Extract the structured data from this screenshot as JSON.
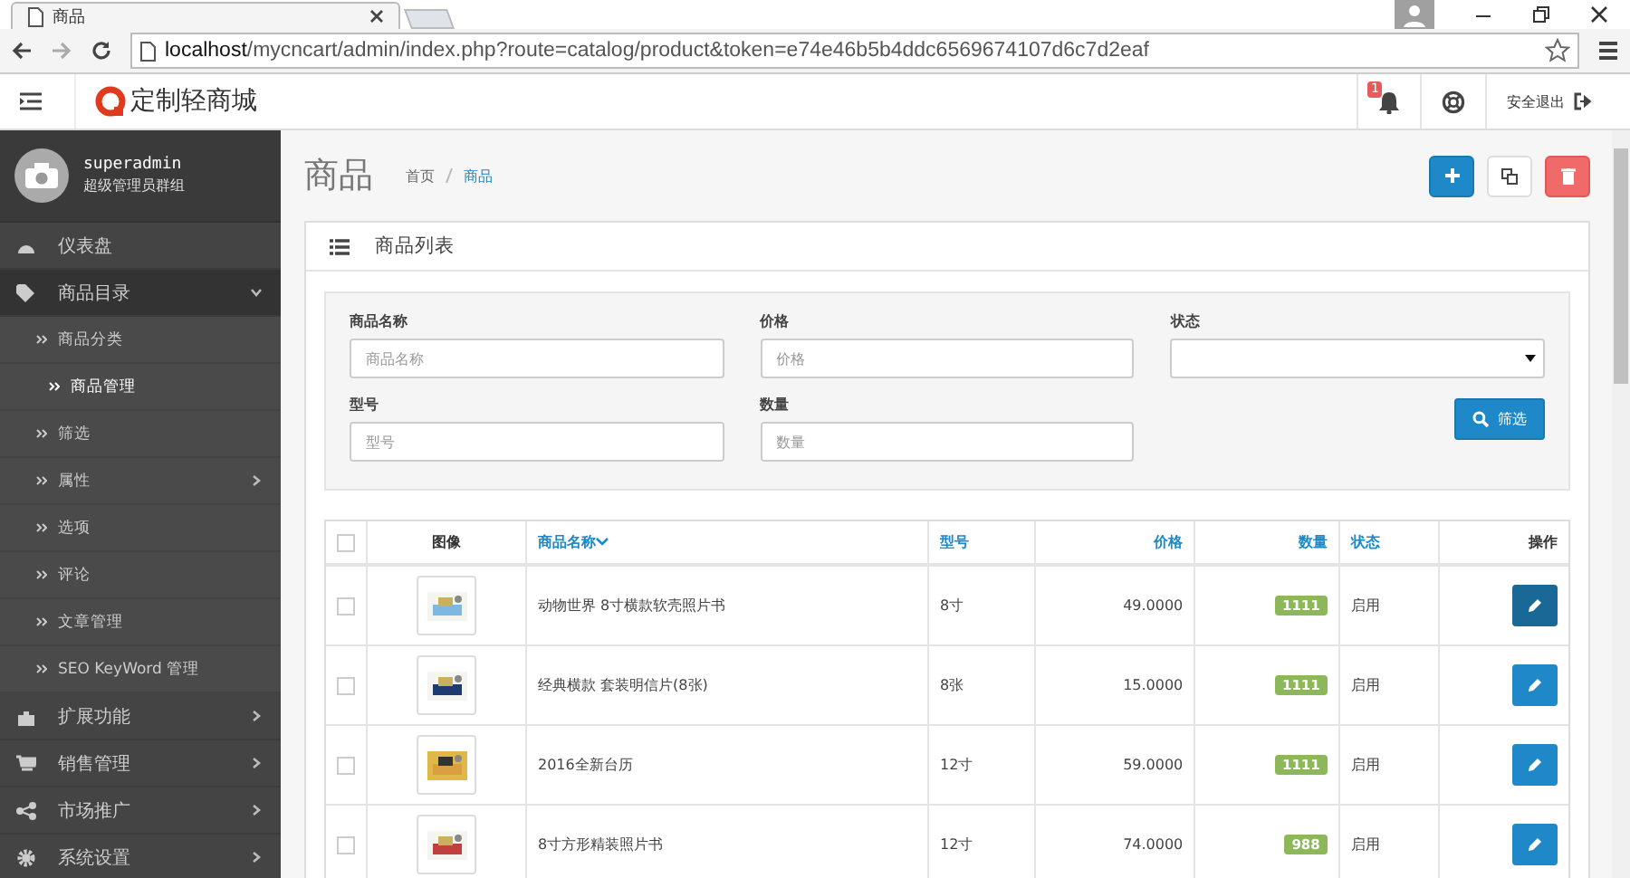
{
  "browser": {
    "tab_title": "商品",
    "url_host": "localhost",
    "url_path": "/mycncart/admin/index.php?route=catalog/product&token=e74e46b5b4ddc6569674107d6c7d2eaf"
  },
  "header": {
    "logo": "定制轻商城",
    "notification_count": "1",
    "logout": "安全退出"
  },
  "user": {
    "name": "superadmin",
    "role": "超级管理员群组"
  },
  "sidebar": {
    "items": [
      {
        "label": "仪表盘",
        "kind": "dashboard",
        "expanded": false,
        "has_children": false
      },
      {
        "label": "商品目录",
        "kind": "tag",
        "expanded": true,
        "has_children": true,
        "children": [
          {
            "label": "商品分类",
            "selected": false,
            "has_children": false
          },
          {
            "label": "商品管理",
            "selected": true,
            "has_children": false
          },
          {
            "label": "筛选",
            "selected": false,
            "has_children": false
          },
          {
            "label": "属性",
            "selected": false,
            "has_children": true
          },
          {
            "label": "选项",
            "selected": false,
            "has_children": false
          },
          {
            "label": "评论",
            "selected": false,
            "has_children": false
          },
          {
            "label": "文章管理",
            "selected": false,
            "has_children": false
          },
          {
            "label": "SEO KeyWord 管理",
            "selected": false,
            "has_children": false
          }
        ]
      },
      {
        "label": "扩展功能",
        "kind": "puzzle",
        "expanded": false,
        "has_children": true
      },
      {
        "label": "销售管理",
        "kind": "cart",
        "expanded": false,
        "has_children": true
      },
      {
        "label": "市场推广",
        "kind": "share",
        "expanded": false,
        "has_children": true
      },
      {
        "label": "系统设置",
        "kind": "gear",
        "expanded": false,
        "has_children": true
      }
    ]
  },
  "page": {
    "title": "商品",
    "breadcrumb": [
      {
        "label": "首页",
        "selected": false
      },
      {
        "label": "商品",
        "selected": true
      }
    ]
  },
  "panel": {
    "title": "商品列表"
  },
  "filter": {
    "fields": [
      {
        "label": "商品名称",
        "placeholder": "商品名称",
        "kind": "input"
      },
      {
        "label": "价格",
        "placeholder": "价格",
        "kind": "input"
      },
      {
        "label": "状态",
        "kind": "select"
      },
      {
        "label": "型号",
        "placeholder": "型号",
        "kind": "input"
      },
      {
        "label": "数量",
        "placeholder": "数量",
        "kind": "input"
      }
    ],
    "button": "筛选"
  },
  "table": {
    "select_all_checked": false,
    "columns": [
      {
        "label": "图像",
        "link": false,
        "sorted": false
      },
      {
        "label": "商品名称",
        "link": true,
        "sorted": true
      },
      {
        "label": "型号",
        "link": true,
        "sorted": false
      },
      {
        "label": "价格",
        "link": true,
        "sorted": false
      },
      {
        "label": "数量",
        "link": true,
        "sorted": false
      },
      {
        "label": "状态",
        "link": true,
        "sorted": false
      },
      {
        "label": "操作",
        "link": false,
        "sorted": false
      }
    ],
    "rows": [
      {
        "name": "动物世界 8寸横款软壳照片书",
        "model": "8寸",
        "price": "49.0000",
        "quantity": "1111",
        "status": "启用",
        "checked": false,
        "edit_active": true
      },
      {
        "name": "经典横款 套装明信片(8张)",
        "model": "8张",
        "price": "15.0000",
        "quantity": "1111",
        "status": "启用",
        "checked": false,
        "edit_active": false
      },
      {
        "name": "2016全新台历",
        "model": "12寸",
        "price": "59.0000",
        "quantity": "1111",
        "status": "启用",
        "checked": false,
        "edit_active": false
      },
      {
        "name": "8寸方形精装照片书",
        "model": "12寸",
        "price": "74.0000",
        "quantity": "988",
        "status": "启用",
        "checked": false,
        "edit_active": false
      }
    ]
  }
}
